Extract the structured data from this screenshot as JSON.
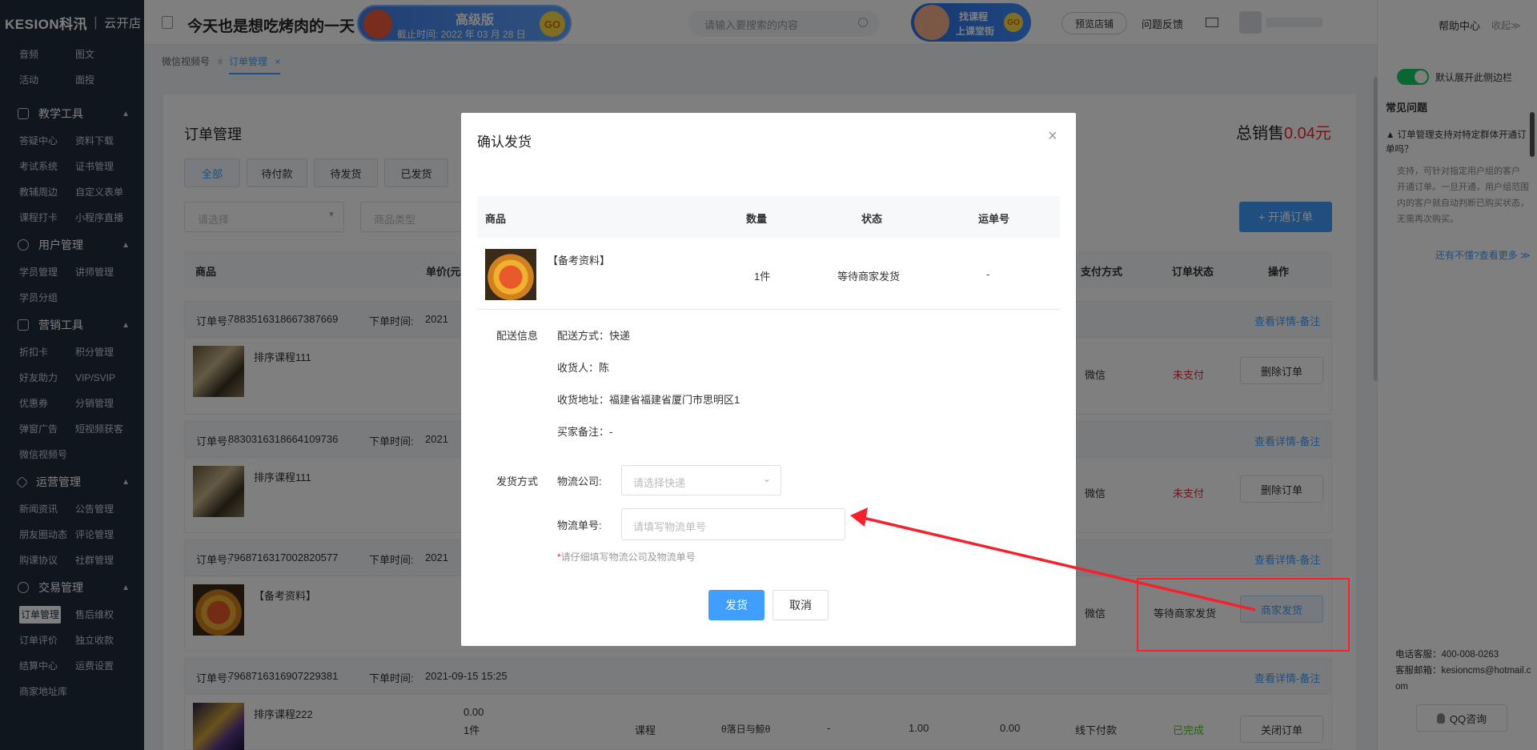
{
  "sidebar": {
    "brand": "KESION科汛",
    "sub": "云开店",
    "top_items": [
      "音频",
      "图文",
      "活动",
      "面授"
    ],
    "sections": [
      {
        "title": "教学工具",
        "items": [
          "答疑中心",
          "资料下载",
          "考试系统",
          "证书管理",
          "教辅周边",
          "自定义表单",
          "课程打卡",
          "小程序直播"
        ]
      },
      {
        "title": "用户管理",
        "items": [
          "学员管理",
          "讲师管理",
          "学员分组"
        ]
      },
      {
        "title": "营销工具",
        "items": [
          "折扣卡",
          "积分管理",
          "好友助力",
          "VIP/SVIP",
          "优惠券",
          "分销管理",
          "弹窗广告",
          "短视频获客",
          "微信视频号"
        ]
      },
      {
        "title": "运营管理",
        "items": [
          "新闻资讯",
          "公告管理",
          "朋友圈动态",
          "评论管理",
          "购课协议",
          "社群管理"
        ]
      },
      {
        "title": "交易管理",
        "items": [
          "订单管理",
          "售后维权",
          "订单评价",
          "独立收款",
          "结算中心",
          "运费设置",
          "商家地址库"
        ]
      }
    ]
  },
  "header": {
    "shop_name": "今天也是想吃烤肉的一天",
    "banner_title": "高级版",
    "banner_expire": "截止时间: 2022 年 03 月 28 日",
    "banner_go": "GO",
    "search_placeholder": "请输入要搜索的内容",
    "promo_line1": "找课程",
    "promo_line2": "上课堂街",
    "preview_shop": "预览店铺",
    "feedback": "问题反馈"
  },
  "page_tabs": [
    {
      "label": "微信视频号",
      "active": false
    },
    {
      "label": "订单管理",
      "active": true
    }
  ],
  "right_panel": {
    "help_center": "帮助中心",
    "collapse": "收起≫",
    "toggle_label": "默认展开此侧边栏",
    "faq_title": "常见问题",
    "faq_q": "▲ 订单管理支持对特定群体开通订单吗？",
    "faq_a": "支持，可针对指定用户组的客户 开通订单。一旦开通，用户组范围内的客户就自动判断已购买状态，无需再次购买。",
    "more": "还有不懂?查看更多 ≫",
    "phone": "电话客服：400-008-0263",
    "email": "客服邮箱：kesioncms@hotmail.com",
    "qq": "QQ咨询"
  },
  "orders_page": {
    "title": "订单管理",
    "total_label": "总销售",
    "total_value": "0.04元",
    "status_tabs": [
      "全部",
      "待付款",
      "待发货",
      "已发货"
    ],
    "filter_select": "请选择",
    "filter_type": "商品类型",
    "open_order_btn": "+ 开通订单",
    "columns": {
      "product": "商品",
      "price": "单价(元",
      "pay_method": "支付方式",
      "order_status": "订单状态",
      "actions": "操作"
    },
    "detail_link": "查看详情-备注",
    "orders": [
      {
        "no_label": "订单号:",
        "no": "7883516318667387669",
        "time_label": "下单时间:",
        "time": "2021",
        "product": "排序课程111",
        "pay": "微信",
        "status": "未支付",
        "action": "删除订单"
      },
      {
        "no_label": "订单号:",
        "no": "8830316318664109736",
        "time_label": "下单时间:",
        "time": "2021",
        "product": "排序课程111",
        "pay": "微信",
        "status": "未支付",
        "action": "删除订单"
      },
      {
        "no_label": "订单号:",
        "no": "7968716317002820577",
        "time_label": "下单时间:",
        "time": "2021",
        "product": "【备考资料】",
        "pay": "微信",
        "status": "等待商家发货",
        "action": "商家发货"
      },
      {
        "no_label": "订单号:",
        "no": "7968716316907229381",
        "time_label": "下单时间:",
        "time": "2021-09-15 15:25",
        "product": "排序课程222",
        "price": "0.00",
        "qty": "1件",
        "type": "课程",
        "buyer": "θ落日与鲸θ",
        "dash": "-",
        "amount": "1.00",
        "discount": "0.00",
        "pay": "线下付款",
        "status": "已完成",
        "action": "关闭订单"
      }
    ]
  },
  "modal": {
    "title": "确认发货",
    "close": "×",
    "cols": {
      "product": "商品",
      "qty": "数量",
      "status": "状态",
      "tracking": "运单号"
    },
    "item": {
      "name": "【备考资料】",
      "qty": "1件",
      "status": "等待商家发货",
      "tracking": "-"
    },
    "delivery_label": "配送信息",
    "delivery_method": "配送方式：快递",
    "receiver": "收货人：陈",
    "address": "收货地址：福建省福建省厦门市思明区1",
    "buyer_note": "买家备注：-",
    "ship_label": "发货方式",
    "company_label": "物流公司:",
    "company_placeholder": "请选择快递",
    "tracking_label": "物流单号:",
    "tracking_placeholder": "请填写物流单号",
    "hint_star": "*",
    "hint": "请仔细填写物流公司及物流单号",
    "confirm": "发货",
    "cancel": "取消"
  },
  "colors": {
    "primary": "#409eff",
    "danger": "#f5222d",
    "success": "#52c41a",
    "sidebar": "#1f2d3d"
  }
}
